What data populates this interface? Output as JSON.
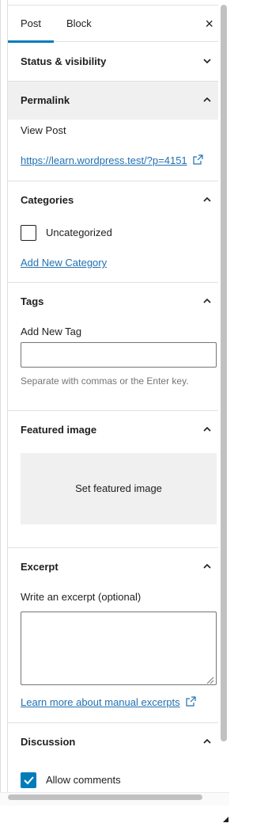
{
  "tabs": {
    "post": "Post",
    "block": "Block",
    "close": "×"
  },
  "panels": {
    "status": {
      "title": "Status & visibility"
    },
    "permalink": {
      "title": "Permalink",
      "view_label": "View Post",
      "url": "https://learn.wordpress.test/?p=4151"
    },
    "categories": {
      "title": "Categories",
      "item": "Uncategorized",
      "add_link": "Add New Category"
    },
    "tags": {
      "title": "Tags",
      "field_label": "Add New Tag",
      "field_value": "",
      "help": "Separate with commas or the Enter key."
    },
    "featured": {
      "title": "Featured image",
      "button": "Set featured image"
    },
    "excerpt": {
      "title": "Excerpt",
      "field_label": "Write an excerpt (optional)",
      "learn_link": "Learn more about manual excerpts"
    },
    "discussion": {
      "title": "Discussion",
      "allow_comments": "Allow comments",
      "allow_comments_checked": true
    }
  },
  "icons": {
    "chevron_up": "chevron-up-icon",
    "chevron_down": "chevron-down-icon",
    "external": "external-link-icon",
    "check": "check-icon"
  },
  "colors": {
    "accent": "#007cba",
    "link": "#2271b1",
    "border": "#e0e0e0"
  }
}
